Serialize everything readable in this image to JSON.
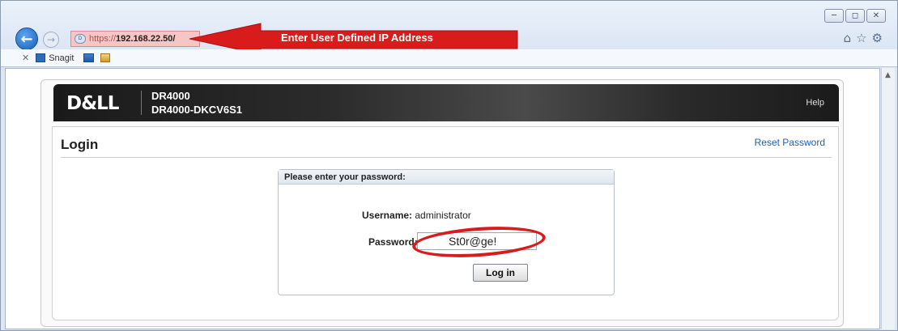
{
  "browser": {
    "address": {
      "scheme": "https://",
      "host": "192.168.22.50/"
    },
    "callout": "Enter User Defined IP Address",
    "favorites": {
      "snagit_label": "Snagit"
    },
    "window_controls": [
      "minimize",
      "maximize",
      "close"
    ],
    "toolbar_icons": [
      "home-icon",
      "star-icon",
      "gear-icon"
    ]
  },
  "banner": {
    "logo": "D&LL",
    "model": "DR4000",
    "system_name": "DR4000-DKCV6S1",
    "help_label": "Help"
  },
  "login": {
    "title": "Login",
    "reset_link": "Reset Password",
    "panel_header": "Please enter your password:",
    "username_label": "Username:",
    "username_value": "administrator",
    "password_label": "Password:",
    "password_value": "St0r@ge!",
    "login_button": "Log in"
  },
  "colors": {
    "callout_red": "#d81c1c",
    "link_blue": "#1e5fb8",
    "banner_dark": "#1a1a1a"
  }
}
